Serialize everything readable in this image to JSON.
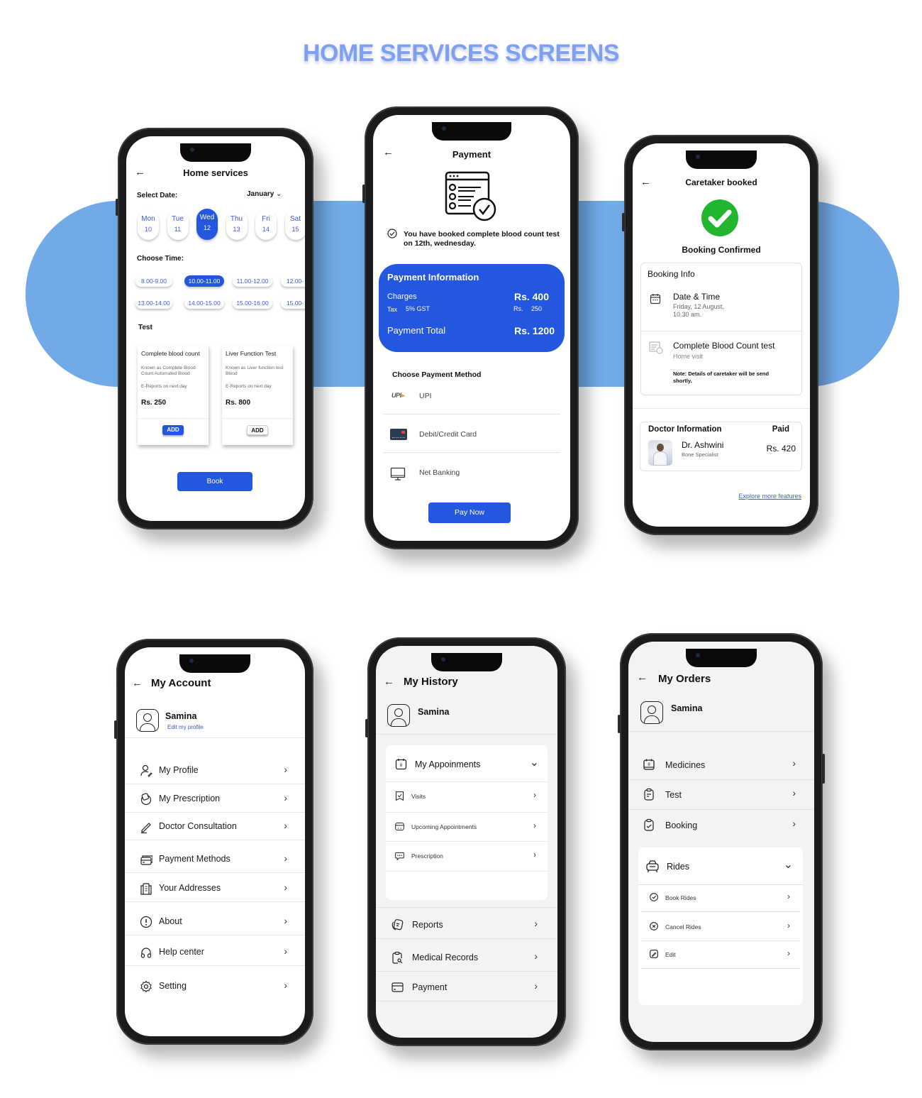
{
  "page_title": "HOME SERVICES SCREENS",
  "colors": {
    "accent_blue": "#2457e0",
    "background_band": "#71aae7",
    "title": "#7fa0f0",
    "success_green": "#22b52e",
    "link": "#3b5bdb"
  },
  "home_services": {
    "back_icon": "arrow-left-icon",
    "title": "Home  services",
    "select_date_label": "Select Date:",
    "month": "January",
    "days": [
      {
        "day": "Mon",
        "date": "10",
        "selected": false
      },
      {
        "day": "Tue",
        "date": "11",
        "selected": false
      },
      {
        "day": "Wed",
        "date": "12",
        "selected": true
      },
      {
        "day": "Thu",
        "date": "13",
        "selected": false
      },
      {
        "day": "Fri",
        "date": "14",
        "selected": false
      },
      {
        "day": "Sat",
        "date": "15",
        "selected": false
      }
    ],
    "choose_time_label": "Choose Time:",
    "times": [
      {
        "label": "8.00-9.00",
        "selected": false
      },
      {
        "label": "10.00-11.00",
        "selected": true
      },
      {
        "label": "11.00-12.00",
        "selected": false
      },
      {
        "label": "12.00-",
        "selected": false
      },
      {
        "label": "13.00-14.00",
        "selected": false
      },
      {
        "label": "14.00-15.00",
        "selected": false
      },
      {
        "label": "15.00-16.00",
        "selected": false
      },
      {
        "label": "15.00-",
        "selected": false
      }
    ],
    "test_label": "Test",
    "tests": [
      {
        "name": "Complete blood count",
        "desc": "Known as Complete Blood Count Automated Blood",
        "report": "E-Reports on next day",
        "price": "Rs. 250",
        "add": "ADD"
      },
      {
        "name": "Liver Function Test",
        "desc": "Known as Liver function test Blood",
        "report": "E-Reports on next day",
        "price": "Rs. 800",
        "add": "ADD"
      }
    ],
    "book_button": "Book"
  },
  "payment": {
    "title": "Payment",
    "confirmation": "You have booked complete blood count test on 12th, wednesday.",
    "info_title": "Payment Information",
    "charges_label": "Charges",
    "charges_value": "Rs. 400",
    "tax_label": "Tax",
    "tax_rate": "5% GST",
    "tax_currency": "Rs.",
    "tax_value": "250",
    "total_label": "Payment Total",
    "total_value": "Rs. 1200",
    "method_label": "Choose  Payment Method",
    "methods": [
      {
        "icon": "upi-logo-icon",
        "label": "UPI"
      },
      {
        "icon": "credit-card-icon",
        "label": "Debit/Credit Card"
      },
      {
        "icon": "monitor-icon",
        "label": "Net Banking"
      }
    ],
    "pay_button": "Pay Now"
  },
  "caretaker": {
    "title": "Caretaker booked",
    "status": "Booking Confirmed",
    "booking_info_title": "Booking Info",
    "date_time_label": "Date & Time",
    "date_time_value_1": "Friday, 12 August,",
    "date_time_value_2": "10.30 am.",
    "test_name": "Complete Blood Count test",
    "test_type": "Home visit",
    "note": "Note: Details of caretaker will be send shortly.",
    "doctor_info_title": "Doctor Information",
    "paid_label": "Paid",
    "doctor_name": "Dr. Ashwini",
    "doctor_specialty": "Bone Specialist",
    "paid_amount": "Rs. 420",
    "explore_link": "Explore more features"
  },
  "my_account": {
    "title": "My Account",
    "user_name": "Samina",
    "edit_profile": "Edit my profile",
    "items": [
      {
        "icon": "user-edit-icon",
        "label": "My Profile"
      },
      {
        "icon": "prescription-icon",
        "label": "My Prescription"
      },
      {
        "icon": "pen-icon",
        "label": "Doctor Consultation"
      },
      {
        "icon": "cards-icon",
        "label": "Payment Methods"
      },
      {
        "icon": "building-icon",
        "label": "Your Addresses"
      },
      {
        "icon": "info-circle-icon",
        "label": "About"
      },
      {
        "icon": "headphones-icon",
        "label": "Help center"
      },
      {
        "icon": "gear-icon",
        "label": "Setting"
      }
    ]
  },
  "my_history": {
    "title": "My History",
    "user_name": "Samina",
    "appointments_label": "My Appoinments",
    "sub_items": [
      {
        "icon": "visit-icon",
        "label": "Visits"
      },
      {
        "icon": "calendar-code-icon",
        "label": "Upcoming Appointments"
      },
      {
        "icon": "chat-dots-icon",
        "label": "Prescription"
      }
    ],
    "items": [
      {
        "icon": "reports-icon",
        "label": "Reports"
      },
      {
        "icon": "clipboard-search-icon",
        "label": "Medical Records"
      },
      {
        "icon": "payment-card-icon",
        "label": "Payment"
      }
    ]
  },
  "my_orders": {
    "title": "My Orders",
    "user_name": "Samina",
    "items": [
      {
        "icon": "calendar-icon",
        "label": "Medicines"
      },
      {
        "icon": "clipboard-list-icon",
        "label": "Test"
      },
      {
        "icon": "clipboard-check-icon",
        "label": "Booking"
      }
    ],
    "rides_label": "Rides",
    "ride_items": [
      {
        "icon": "check-circle-icon",
        "label": "Book Rides"
      },
      {
        "icon": "x-circle-icon",
        "label": "Cancel Rides"
      },
      {
        "icon": "edit-icon",
        "label": "Edit"
      }
    ]
  }
}
